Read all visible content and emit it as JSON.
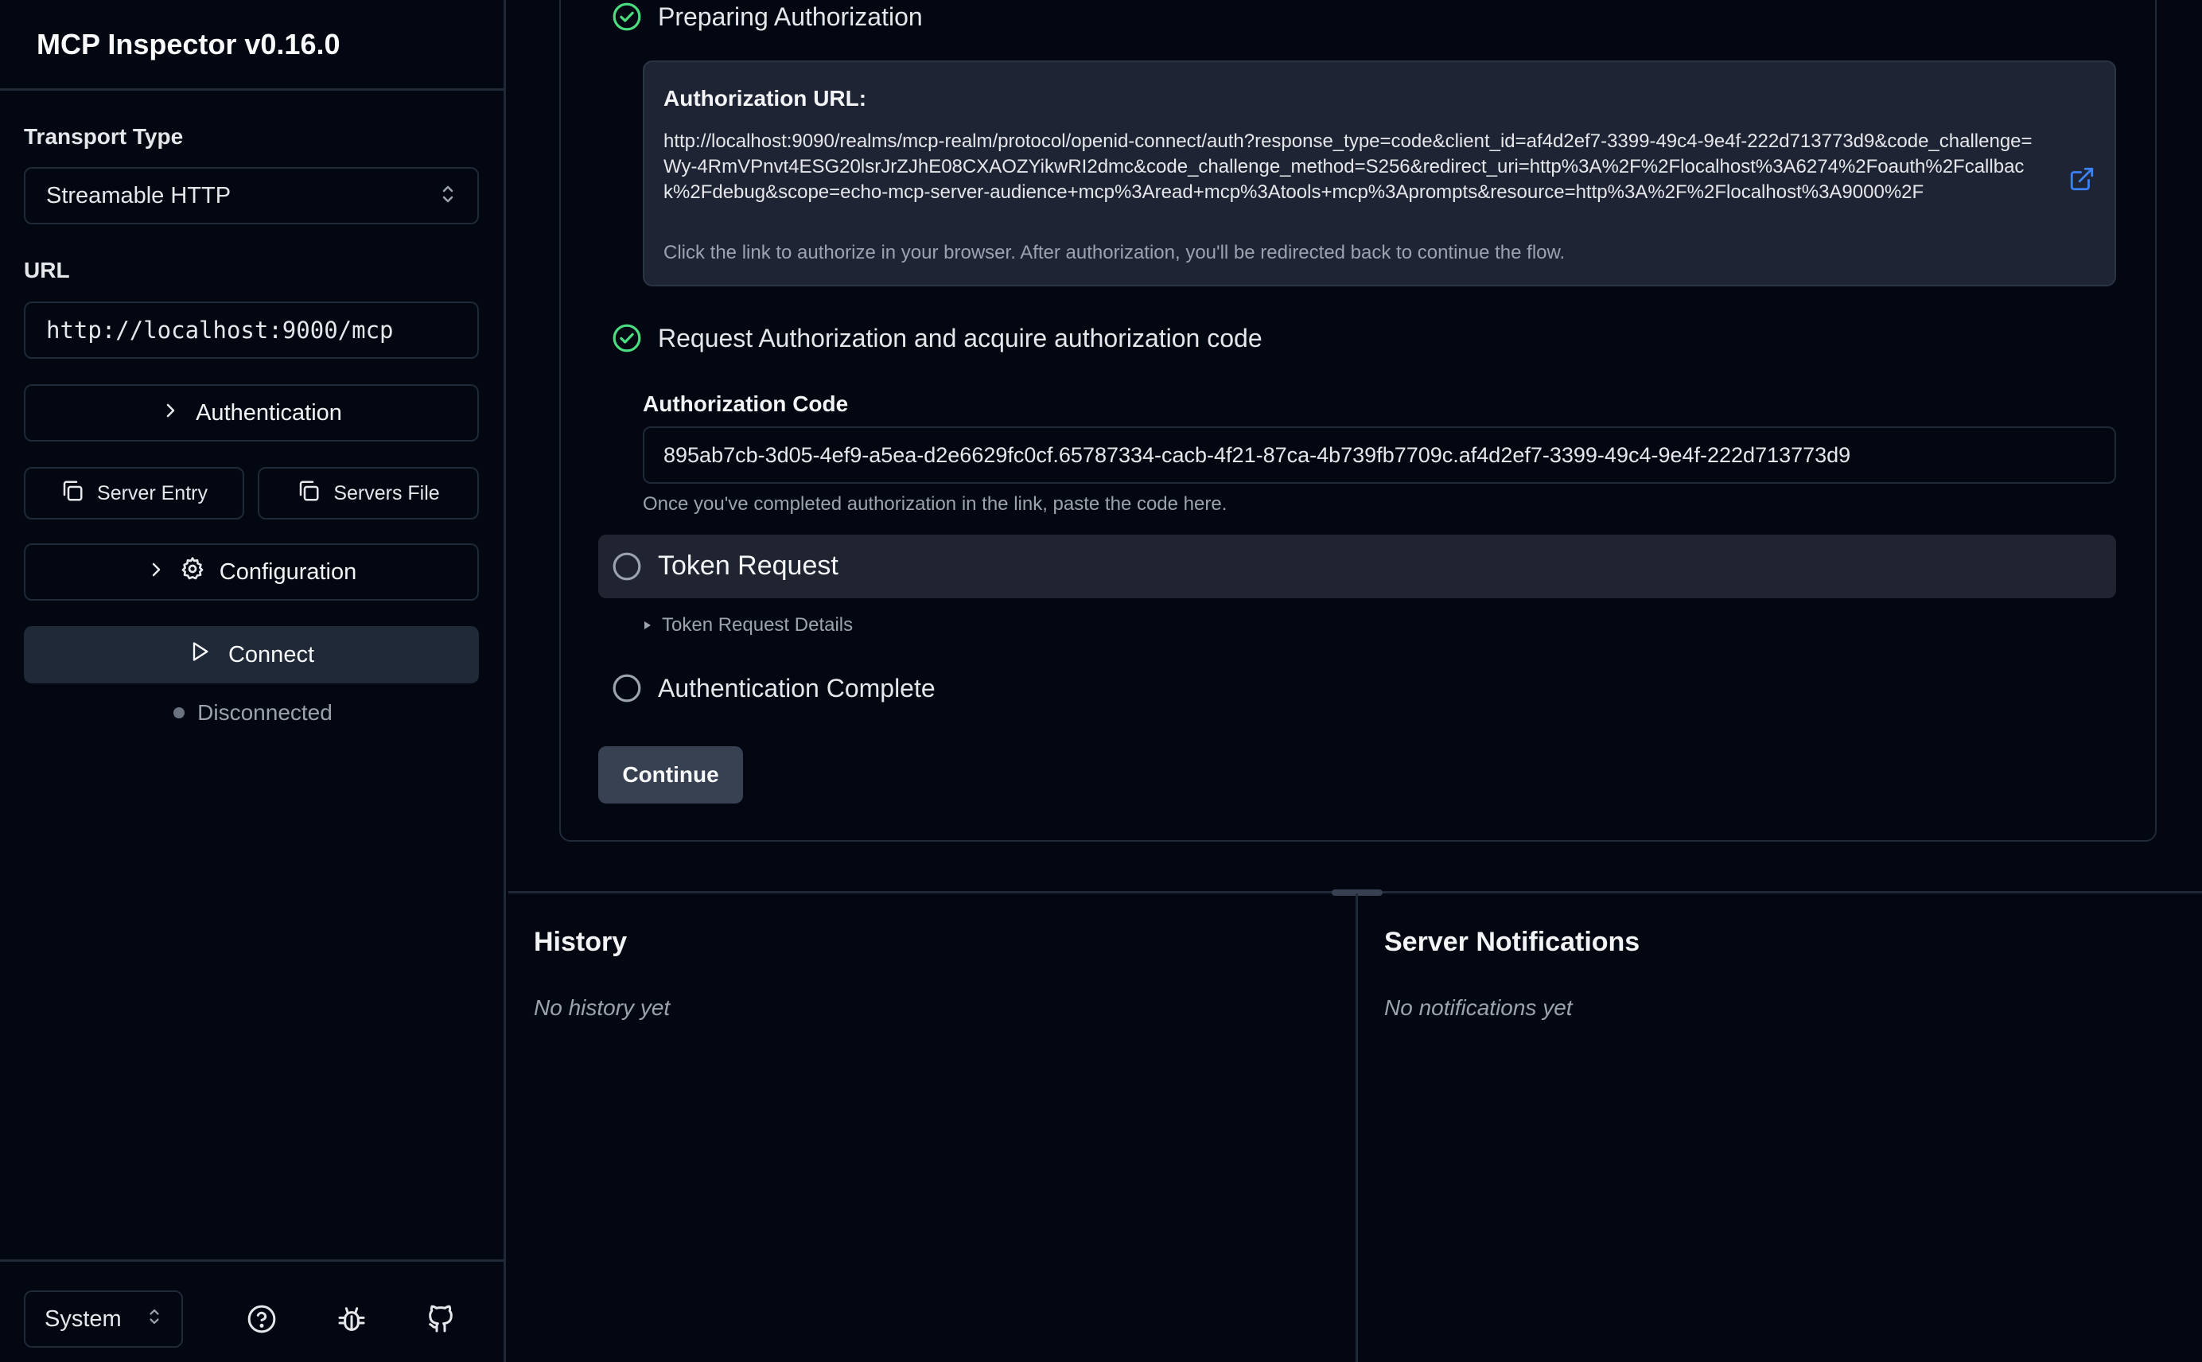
{
  "app": {
    "title": "MCP Inspector v0.16.0"
  },
  "sidebar": {
    "transport_label": "Transport Type",
    "transport_value": "Streamable HTTP",
    "url_label": "URL",
    "url_value": "http://localhost:9000/mcp",
    "authentication_label": "Authentication",
    "server_entry_label": "Server Entry",
    "servers_file_label": "Servers File",
    "configuration_label": "Configuration",
    "connect_label": "Connect",
    "status_text": "Disconnected",
    "theme_value": "System"
  },
  "auth_flow": {
    "step_preparing": "Preparing Authorization",
    "auth_url_title": "Authorization URL:",
    "auth_url": "http://localhost:9090/realms/mcp-realm/protocol/openid-connect/auth?response_type=code&client_id=af4d2ef7-3399-49c4-9e4f-222d713773d9&code_challenge=Wy-4RmVPnvt4ESG20lsrJrZJhE08CXAOZYikwRI2dmc&code_challenge_method=S256&redirect_uri=http%3A%2F%2Flocalhost%3A6274%2Foauth%2Fcallback%2Fdebug&scope=echo-mcp-server-audience+mcp%3Aread+mcp%3Atools+mcp%3Aprompts&resource=http%3A%2F%2Flocalhost%3A9000%2F",
    "auth_url_hint": "Click the link to authorize in your browser. After authorization, you'll be redirected back to continue the flow.",
    "step_request": "Request Authorization and acquire authorization code",
    "code_label": "Authorization Code",
    "code_value": "895ab7cb-3d05-4ef9-a5ea-d2e6629fc0cf.65787334-cacb-4f21-87ca-4b739fb7709c.af4d2ef7-3399-49c4-9e4f-222d713773d9",
    "code_hint": "Once you've completed authorization in the link, paste the code here.",
    "step_token": "Token Request",
    "token_details": "Token Request Details",
    "step_complete": "Authentication Complete",
    "continue_label": "Continue"
  },
  "panels": {
    "history_title": "History",
    "history_empty": "No history yet",
    "notifications_title": "Server Notifications",
    "notifications_empty": "No notifications yet"
  },
  "colors": {
    "background": "#030712",
    "border": "#1f2937",
    "success": "#4ade80",
    "link": "#3b82f6"
  }
}
